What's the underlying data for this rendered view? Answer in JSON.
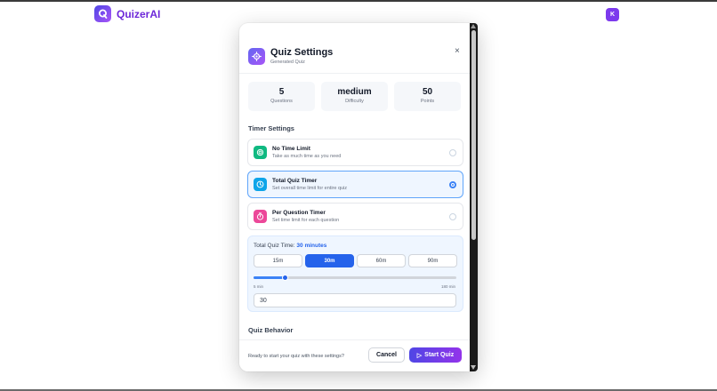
{
  "app": {
    "name": "QuizerAI",
    "avatar_initial": "K"
  },
  "modal": {
    "title": "Quiz Settings",
    "subtitle": "Generated Quiz",
    "close_label": "×"
  },
  "stats": [
    {
      "value": "5",
      "label": "Questions"
    },
    {
      "value": "medium",
      "label": "Difficulty"
    },
    {
      "value": "50",
      "label": "Points"
    }
  ],
  "timer": {
    "section_title": "Timer Settings",
    "options": [
      {
        "title": "No Time Limit",
        "desc": "Take as much time as you need",
        "color": "#10b981",
        "selected": false
      },
      {
        "title": "Total Quiz Timer",
        "desc": "Set overall time limit for entire quiz",
        "color": "#0ea5e9",
        "selected": true
      },
      {
        "title": "Per Question Timer",
        "desc": "Set time limit for each question",
        "color": "#ec4899",
        "selected": false
      }
    ],
    "total_label": "Total Quiz Time:",
    "total_value": "30 minutes",
    "presets": [
      "15m",
      "30m",
      "60m",
      "90m"
    ],
    "active_preset": "30m",
    "slider_min_label": "5 min",
    "slider_max_label": "180 min",
    "slider_fraction": 0.155,
    "input_value": "30"
  },
  "behavior": {
    "section_title": "Quiz Behavior"
  },
  "footer": {
    "prompt": "Ready to start your quiz with these settings?",
    "cancel_label": "Cancel",
    "start_label": "Start Quiz",
    "start_icon": "▷"
  },
  "colors": {
    "brand": "#6d28d9",
    "accent": "#2563eb"
  }
}
